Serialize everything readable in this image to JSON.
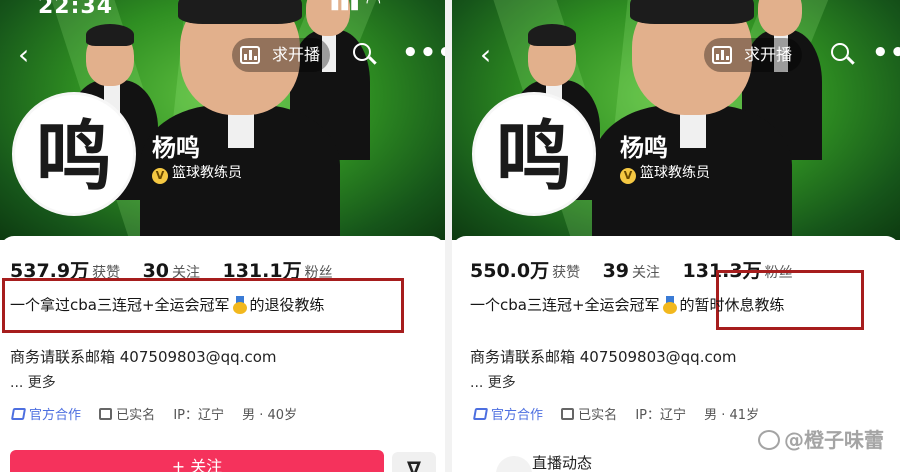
{
  "left": {
    "status_time": "22:34",
    "nav": {
      "back": "‹",
      "pill_label": "求开播",
      "more": "•••"
    },
    "profile": {
      "name": "杨鸣",
      "verify_label": "篮球教练员",
      "verify_mark": "V",
      "avatar_glyph": "鸣"
    },
    "stats": [
      {
        "value": "537.9万",
        "label": "获赞"
      },
      {
        "value": "30",
        "label": "关注"
      },
      {
        "value": "131.1万",
        "label": "粉丝"
      }
    ],
    "bio": {
      "before": "一个拿过cba三连冠+全运会冠军",
      "after": "的退役教练"
    },
    "contact": "商务请联系邮箱  407509803@qq.com",
    "more": "... 更多",
    "tags": [
      "官方合作",
      "已实名",
      "IP：辽宁",
      "男 · 40岁"
    ],
    "follow_button": "+ 关注",
    "share_button": "∇"
  },
  "right": {
    "nav": {
      "back": "‹",
      "pill_label": "求开播",
      "more": "•••"
    },
    "profile": {
      "name": "杨鸣",
      "verify_label": "篮球教练员",
      "verify_mark": "V",
      "avatar_glyph": "鸣"
    },
    "stats": [
      {
        "value": "550.0万",
        "label": "获赞"
      },
      {
        "value": "39",
        "label": "关注"
      },
      {
        "value": "131.3万",
        "label": "粉丝"
      }
    ],
    "bio": {
      "before": "一个cba三连冠+全运会冠军",
      "after": "的暂时休息教练"
    },
    "contact": "商务请联系邮箱  407509803@qq.com",
    "more": "... 更多",
    "tags": [
      "官方合作",
      "已实名",
      "IP：辽宁",
      "男 · 41岁"
    ],
    "live_label": "直播动态"
  },
  "watermark": "@橙子味蕾",
  "colors": {
    "highlight": "#a61d1d",
    "follow": "#f5325c",
    "banner": "#2f8f22"
  },
  "icons": [
    "back-icon",
    "chart-icon",
    "search-icon",
    "more-icon",
    "verified-icon",
    "medal-icon",
    "cooperation-icon",
    "id-icon"
  ]
}
